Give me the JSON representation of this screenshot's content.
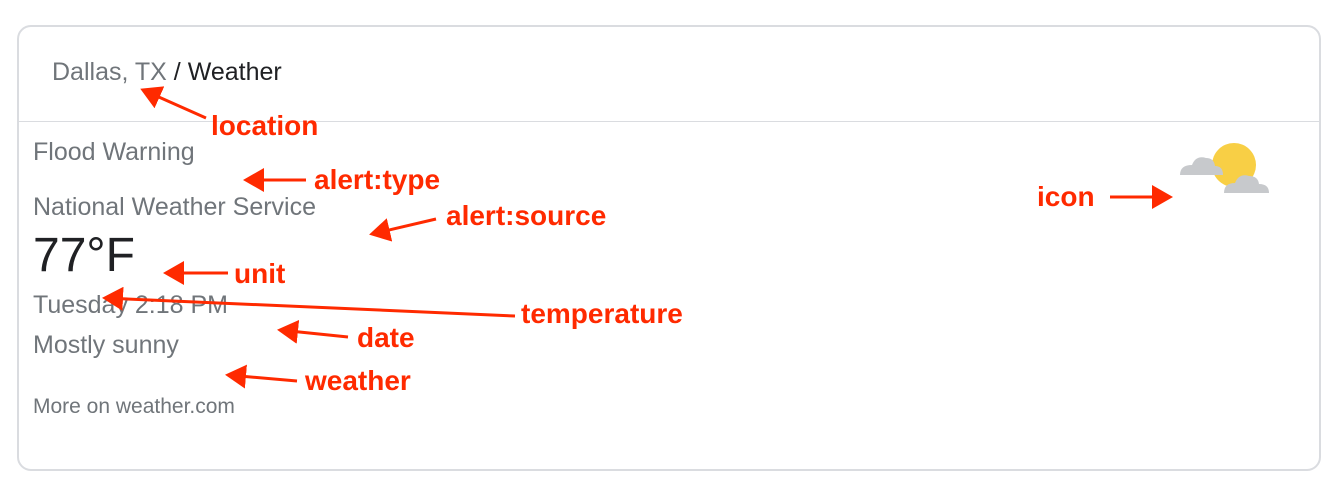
{
  "breadcrumb": {
    "location": "Dallas, TX",
    "separator": " / ",
    "page": "Weather"
  },
  "alert": {
    "type": "Flood Warning",
    "source": "National Weather Service"
  },
  "current": {
    "temperature": "77",
    "unit": "°F",
    "date": "Tuesday 2:18 PM",
    "condition": "Mostly sunny",
    "icon": "partly-sunny-icon"
  },
  "footer": {
    "more_link": "More on weather.com"
  },
  "annotations": {
    "location": "location",
    "alert_type": "alert:type",
    "alert_source": "alert:source",
    "unit": "unit",
    "temperature": "temperature",
    "date": "date",
    "weather": "weather",
    "icon": "icon"
  },
  "colors": {
    "annotation": "#ff2a00",
    "sun": "#f8cf45",
    "cloud": "#c7c9cc"
  }
}
